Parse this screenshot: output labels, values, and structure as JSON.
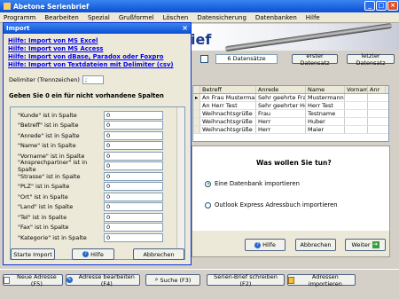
{
  "window": {
    "title": "Abetone Serienbrief"
  },
  "menu": [
    "Programm",
    "Bearbeiten",
    "Spezial",
    "Grußformel",
    "Löschen",
    "Datensicherung",
    "Datenbanken",
    "Hilfe"
  ],
  "banner": {
    "text_partial": "ief"
  },
  "toolbar": {
    "count": "6 Datensätze",
    "first": "erster Datensatz",
    "last": "letzter Datensatz"
  },
  "grid": {
    "headers": [
      "Betreff",
      "Anrede",
      "Name",
      "Vorname",
      "Anr"
    ],
    "rows": [
      [
        "An Frau Mustermann",
        "Sehr geehrte Frau",
        "Mustermann"
      ],
      [
        "An Herr Test",
        "Sehr geehrter Herr",
        "Herr Test"
      ],
      [
        "Weihnachtsgrüße",
        "Frau",
        "Testname"
      ],
      [
        "Weihnachtsgrüße",
        "Herr",
        "Huber"
      ],
      [
        "Weihnachtsgrüße",
        "Herr",
        "Maier"
      ]
    ]
  },
  "wizard": {
    "question": "Was wollen Sie tun?",
    "option1": "Eine Datenbank importieren",
    "option2": "Outlook Express Adressbuch importieren",
    "help": "Hilfe",
    "cancel": "Abbrechen",
    "next": "Weiter"
  },
  "import": {
    "title": "Import",
    "links": [
      "Hilfe: Import von MS Excel",
      "Hilfe: Import von MS Access",
      "Hilfe: Import von dBase, Paradox oder Foxpro",
      "Hilfe: Import von Textdateien mit Delimiter (csv)"
    ],
    "delimiter_label": "Delimiter (Trennzeichen)",
    "delimiter_value": ";",
    "instruction": "Geben Sie 0 ein für nicht vorhandene Spalten",
    "fields": [
      {
        "label": "\"Kunde\" ist in Spalte",
        "value": "0"
      },
      {
        "label": "\"Betreff\" ist in Spalte",
        "value": "0"
      },
      {
        "label": "\"Anrede\" ist in Spalte",
        "value": "0"
      },
      {
        "label": "\"Name\" ist in Spalte",
        "value": "0"
      },
      {
        "label": "\"Vorname\" ist in Spalte",
        "value": "0"
      },
      {
        "label": "\"Ansprechpartner\" ist in Spalte",
        "value": "0"
      },
      {
        "label": "\"Strasse\" ist in Spalte",
        "value": "0"
      },
      {
        "label": "\"PLZ\" ist in Spalte",
        "value": "0"
      },
      {
        "label": "\"Ort\" ist in Spalte",
        "value": "0"
      },
      {
        "label": "\"Land\" ist in Spalte",
        "value": "0"
      },
      {
        "label": "\"Tel\" ist in Spalte",
        "value": "0"
      },
      {
        "label": "\"Fax\" ist in Spalte",
        "value": "0"
      },
      {
        "label": "\"Kategorie\" ist in Spalte",
        "value": "0"
      }
    ],
    "start": "Starte Import",
    "help": "Hilfe",
    "cancel": "Abbrechen"
  },
  "bottom": {
    "new": "Neue Adresse (F5)",
    "edit": "Adresse bearbeiten (F4)",
    "search": "Suche (F3)",
    "letter": "Serien-Brief schreiben (F2)",
    "import": "Adressen importieren"
  }
}
